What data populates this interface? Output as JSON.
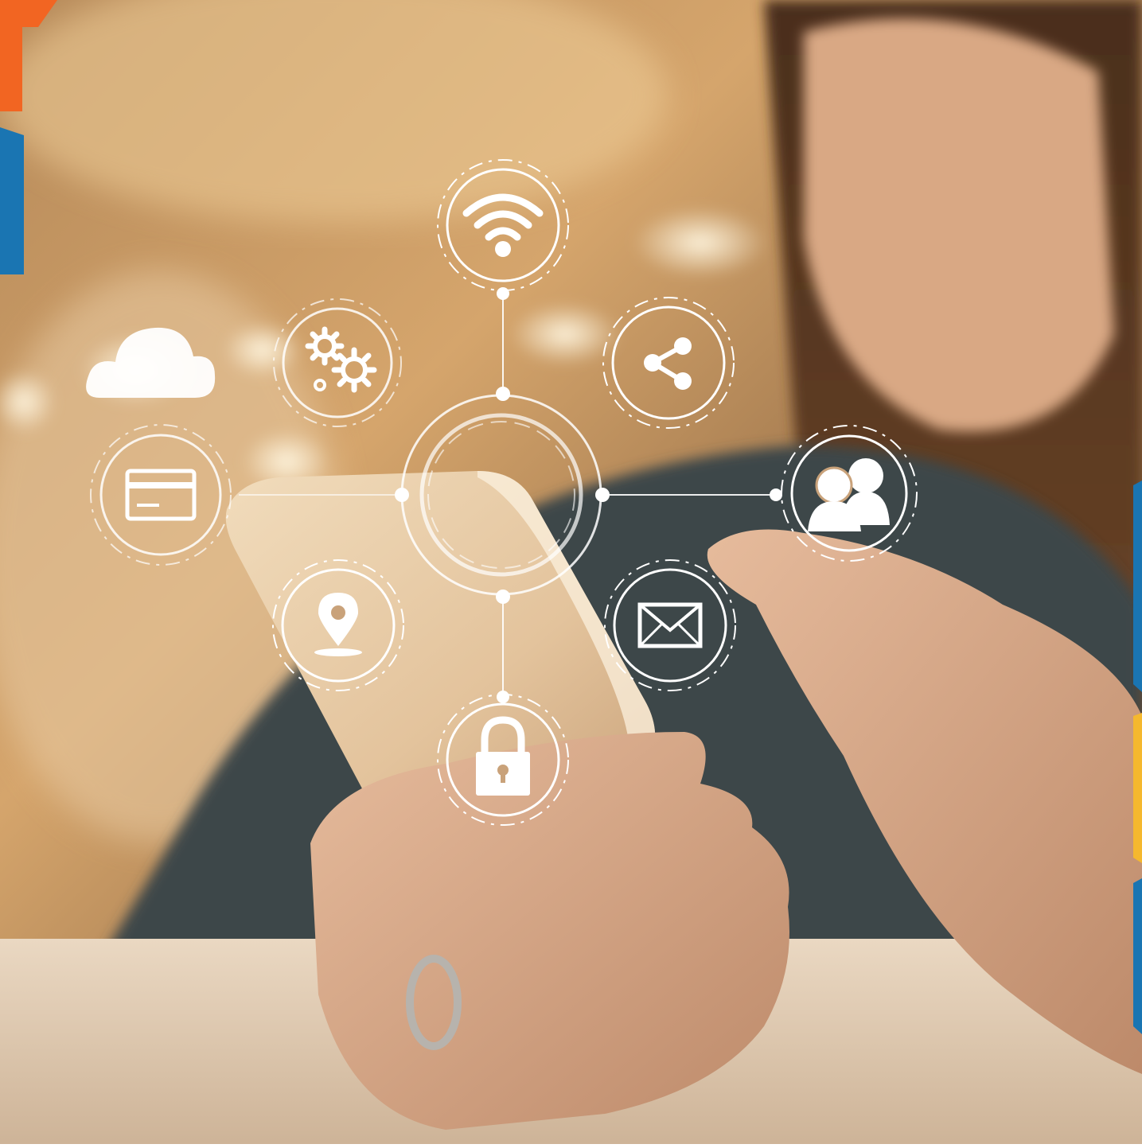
{
  "colors": {
    "bg_warm": "#c89a62",
    "bg_light": "#f3dcb6",
    "bg_dark": "#6e4a2a",
    "table": "#e6d3bd",
    "sleeve": "#3f4648",
    "skin": "#dcae8e",
    "phone": "#e8cfae",
    "accent_orange": "#f26522",
    "accent_blue": "#1a75b2",
    "accent_yellow": "#f5b82e",
    "overlay": "#ffffff"
  },
  "hub": {
    "center_icon": "hub-ring",
    "nodes": [
      {
        "id": "wifi",
        "icon": "wifi-icon"
      },
      {
        "id": "share",
        "icon": "share-icon"
      },
      {
        "id": "users",
        "icon": "users-icon"
      },
      {
        "id": "mail",
        "icon": "mail-icon"
      },
      {
        "id": "lock",
        "icon": "lock-icon"
      },
      {
        "id": "location",
        "icon": "location-pin-icon"
      },
      {
        "id": "card",
        "icon": "credit-card-icon"
      },
      {
        "id": "settings",
        "icon": "gears-icon"
      },
      {
        "id": "cloud",
        "icon": "cloud-icon"
      }
    ]
  }
}
